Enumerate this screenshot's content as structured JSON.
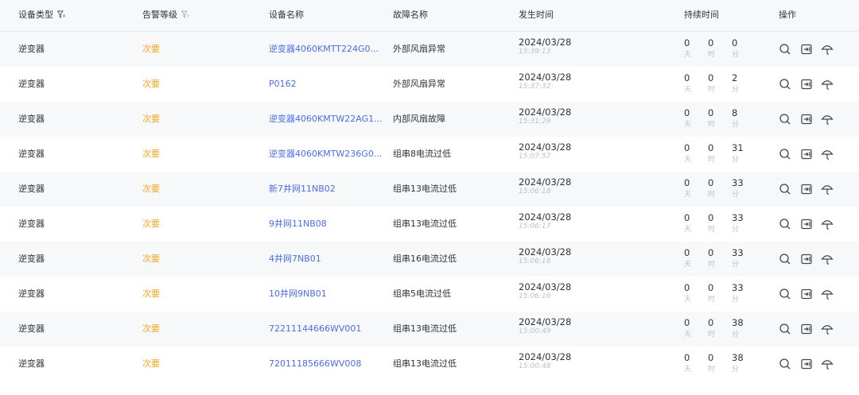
{
  "header": {
    "device_type": "设备类型",
    "alarm_level": "告警等级",
    "device_name": "设备名称",
    "fault_name": "故障名称",
    "occur_time": "发生时间",
    "duration": "持续时间",
    "operation": "操作"
  },
  "colors": {
    "level": "#f5a623",
    "link": "#4b6ee8",
    "header_bg": "#f7f8fa"
  },
  "units": {
    "day": "天",
    "hour": "时",
    "minute": "分"
  },
  "icons": [
    "search-icon",
    "export-icon",
    "umbrella-icon"
  ],
  "rows": [
    {
      "type": "逆变器",
      "level": "次要",
      "name": "逆变器4060KMTT224G0...",
      "fault": "外部风扇异常",
      "date": "2024/03/28",
      "time": "15:39:13",
      "days": "0",
      "hours": "0",
      "minutes": "0"
    },
    {
      "type": "逆变器",
      "level": "次要",
      "name": "P0162",
      "fault": "外部风扇异常",
      "date": "2024/03/28",
      "time": "15:37:32",
      "days": "0",
      "hours": "0",
      "minutes": "2"
    },
    {
      "type": "逆变器",
      "level": "次要",
      "name": "逆变器4060KMTW22AG1...",
      "fault": "内部风扇故障",
      "date": "2024/03/28",
      "time": "15:31:29",
      "days": "0",
      "hours": "0",
      "minutes": "8"
    },
    {
      "type": "逆变器",
      "level": "次要",
      "name": "逆变器4060KMTW236G0...",
      "fault": "组串8电流过低",
      "date": "2024/03/28",
      "time": "15:07:57",
      "days": "0",
      "hours": "0",
      "minutes": "31"
    },
    {
      "type": "逆变器",
      "level": "次要",
      "name": "新7井网11NB02",
      "fault": "组串13电流过低",
      "date": "2024/03/28",
      "time": "15:06:18",
      "days": "0",
      "hours": "0",
      "minutes": "33"
    },
    {
      "type": "逆变器",
      "level": "次要",
      "name": "9井网11NB08",
      "fault": "组串13电流过低",
      "date": "2024/03/28",
      "time": "15:06:17",
      "days": "0",
      "hours": "0",
      "minutes": "33"
    },
    {
      "type": "逆变器",
      "level": "次要",
      "name": "4井网7NB01",
      "fault": "组串16电流过低",
      "date": "2024/03/28",
      "time": "15:06:16",
      "days": "0",
      "hours": "0",
      "minutes": "33"
    },
    {
      "type": "逆变器",
      "level": "次要",
      "name": "10井网9NB01",
      "fault": "组串5电流过低",
      "date": "2024/03/28",
      "time": "15:06:16",
      "days": "0",
      "hours": "0",
      "minutes": "33"
    },
    {
      "type": "逆变器",
      "level": "次要",
      "name": "72211144666WV001",
      "fault": "组串13电流过低",
      "date": "2024/03/28",
      "time": "15:00:49",
      "days": "0",
      "hours": "0",
      "minutes": "38"
    },
    {
      "type": "逆变器",
      "level": "次要",
      "name": "72011185666WV008",
      "fault": "组串13电流过低",
      "date": "2024/03/28",
      "time": "15:00:48",
      "days": "0",
      "hours": "0",
      "minutes": "38"
    }
  ]
}
